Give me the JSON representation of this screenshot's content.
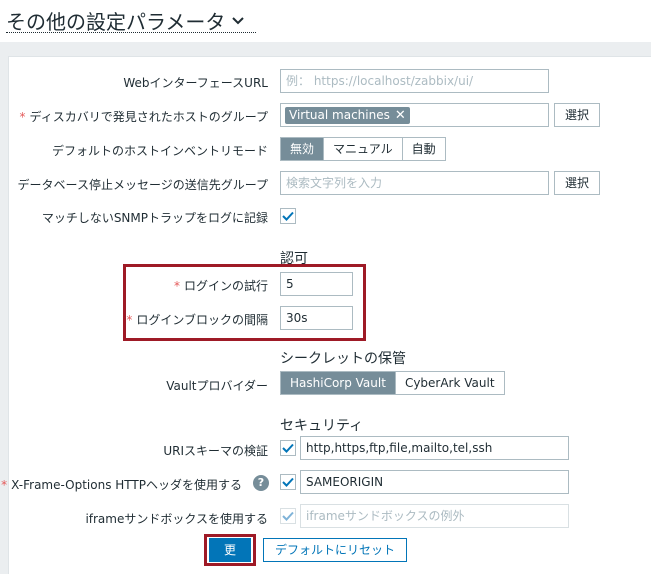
{
  "page": {
    "title": "その他の設定パラメータ"
  },
  "form": {
    "web_url": {
      "label": "WebインターフェースURL",
      "placeholder": "例： https://localhost/zabbix/ui/"
    },
    "discovery_group": {
      "label": "ディスカバリで発見されたホストのグループ",
      "tag": "Virtual machines",
      "select_label": "選択"
    },
    "inventory_mode": {
      "label": "デフォルトのホストインベントリモード",
      "options": [
        "無効",
        "マニュアル",
        "自動"
      ],
      "selected": "無効"
    },
    "alert_group": {
      "label": "データベース停止メッセージの送信先グループ",
      "placeholder": "検索文字列を入力",
      "select_label": "選択"
    },
    "snmp_log": {
      "label": "マッチしないSNMPトラップをログに記録",
      "checked": true
    }
  },
  "auth": {
    "heading": "認可",
    "login_attempts": {
      "label": "ログインの試行",
      "value": "5"
    },
    "login_block": {
      "label": "ログインブロックの間隔",
      "value": "30s"
    }
  },
  "secrets": {
    "heading": "シークレットの保管",
    "vault": {
      "label": "Vaultプロバイダー",
      "options": [
        "HashiCorp Vault",
        "CyberArk Vault"
      ],
      "selected": "HashiCorp Vault"
    }
  },
  "security": {
    "heading": "セキュリティ",
    "uri_schemes": {
      "label": "URIスキーマの検証",
      "checked": true,
      "value": "http,https,ftp,file,mailto,tel,ssh"
    },
    "x_frame": {
      "label": "X-Frame-Options HTTPヘッダを使用する",
      "help": "?",
      "checked": true,
      "value": "SAMEORIGIN"
    },
    "iframe_sandbox": {
      "label": "iframeサンドボックスを使用する",
      "checked": true,
      "placeholder": "iframeサンドボックスの例外"
    }
  },
  "actions": {
    "update": "更新",
    "reset": "デフォルトにリセット"
  },
  "colors": {
    "primary": "#0275b8",
    "segment_active": "#768d99",
    "required": "#e45959",
    "highlight": "#9e1a26"
  }
}
